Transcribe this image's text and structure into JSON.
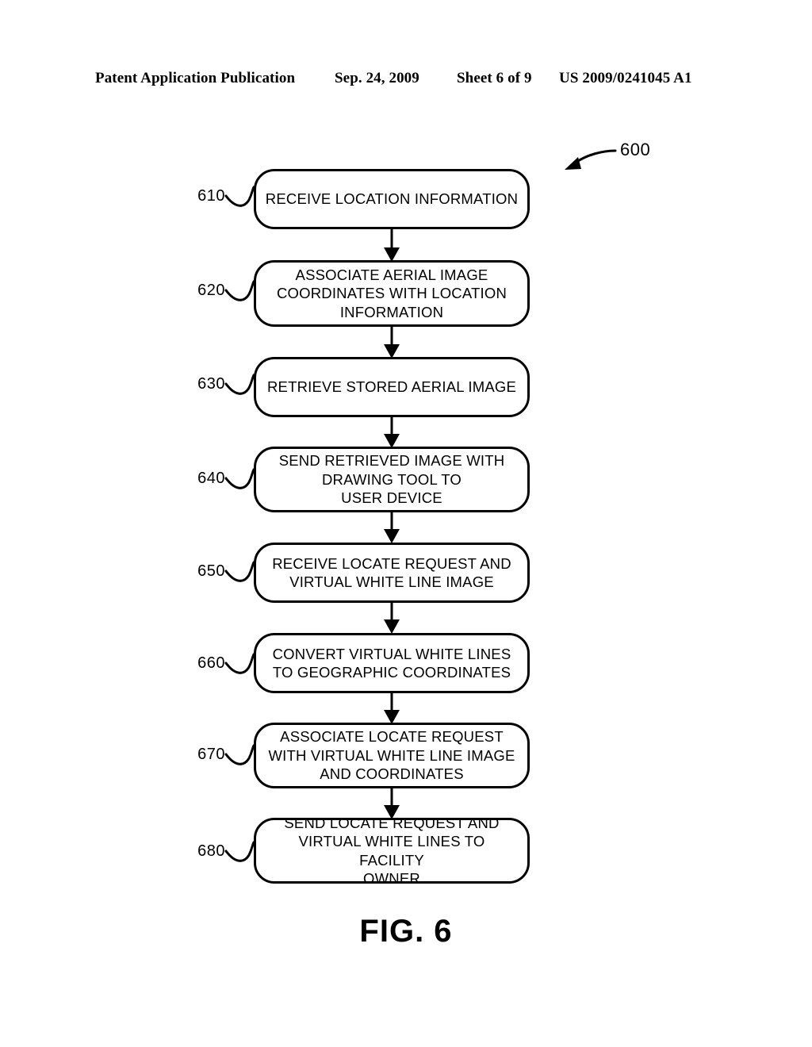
{
  "header": {
    "publication": "Patent Application Publication",
    "date": "Sep. 24, 2009",
    "sheet": "Sheet 6 of 9",
    "patent_number": "US 2009/0241045 A1"
  },
  "figure": {
    "caption": "FIG. 6",
    "diagram_reference": "600"
  },
  "flowchart": {
    "steps": [
      {
        "ref": "610",
        "text": "RECEIVE LOCATION INFORMATION"
      },
      {
        "ref": "620",
        "text": "ASSOCIATE AERIAL IMAGE\nCOORDINATES WITH LOCATION\nINFORMATION"
      },
      {
        "ref": "630",
        "text": "RETRIEVE STORED AERIAL IMAGE"
      },
      {
        "ref": "640",
        "text": "SEND RETRIEVED IMAGE WITH\nDRAWING TOOL TO\nUSER DEVICE"
      },
      {
        "ref": "650",
        "text": "RECEIVE LOCATE REQUEST AND\nVIRTUAL WHITE LINE IMAGE"
      },
      {
        "ref": "660",
        "text": "CONVERT VIRTUAL WHITE LINES\nTO GEOGRAPHIC COORDINATES"
      },
      {
        "ref": "670",
        "text": "ASSOCIATE LOCATE REQUEST\nWITH VIRTUAL WHITE LINE IMAGE\nAND COORDINATES"
      },
      {
        "ref": "680",
        "text": "SEND LOCATE REQUEST AND\nVIRTUAL WHITE LINES TO FACILITY\nOWNER"
      }
    ]
  },
  "colors": {
    "ink": "#000000",
    "paper": "#ffffff"
  }
}
